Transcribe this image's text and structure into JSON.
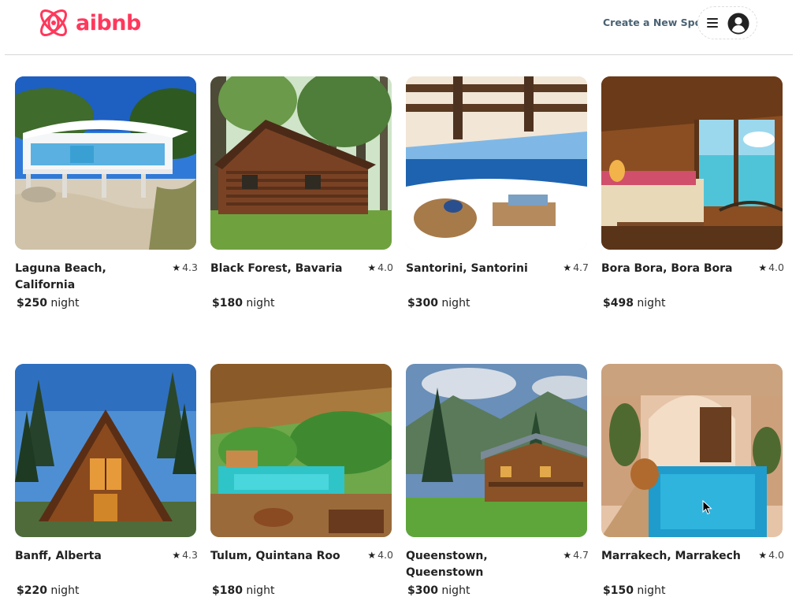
{
  "brand": {
    "name": "aibnb",
    "color": "#ff385c"
  },
  "header": {
    "create_spot_label": "Create a New Spot",
    "menu_icon": "hamburger-menu-icon",
    "user_icon": "user-circle-icon"
  },
  "listings": [
    {
      "name": "Laguna Beach, California",
      "rating": "4.3",
      "price": "$250",
      "unit": "night",
      "image": "beach-house"
    },
    {
      "name": "Black Forest, Bavaria",
      "rating": "4.0",
      "price": "$180",
      "unit": "night",
      "image": "log-cabin-forest"
    },
    {
      "name": "Santorini, Santorini",
      "rating": "4.7",
      "price": "$300",
      "unit": "night",
      "image": "santorini-terrace"
    },
    {
      "name": "Bora Bora, Bora Bora",
      "rating": "4.0",
      "price": "$498",
      "unit": "night",
      "image": "overwater-bungalow"
    },
    {
      "name": "Banff, Alberta",
      "rating": "4.3",
      "price": "$220",
      "unit": "night",
      "image": "a-frame-cabin"
    },
    {
      "name": "Tulum, Quintana Roo",
      "rating": "4.0",
      "price": "$180",
      "unit": "night",
      "image": "jungle-pool"
    },
    {
      "name": "Queenstown, Queenstown",
      "rating": "4.7",
      "price": "$300",
      "unit": "night",
      "image": "mountain-lodge"
    },
    {
      "name": "Marrakech, Marrakech",
      "rating": "4.0",
      "price": "$150",
      "unit": "night",
      "image": "riad-pool"
    }
  ]
}
